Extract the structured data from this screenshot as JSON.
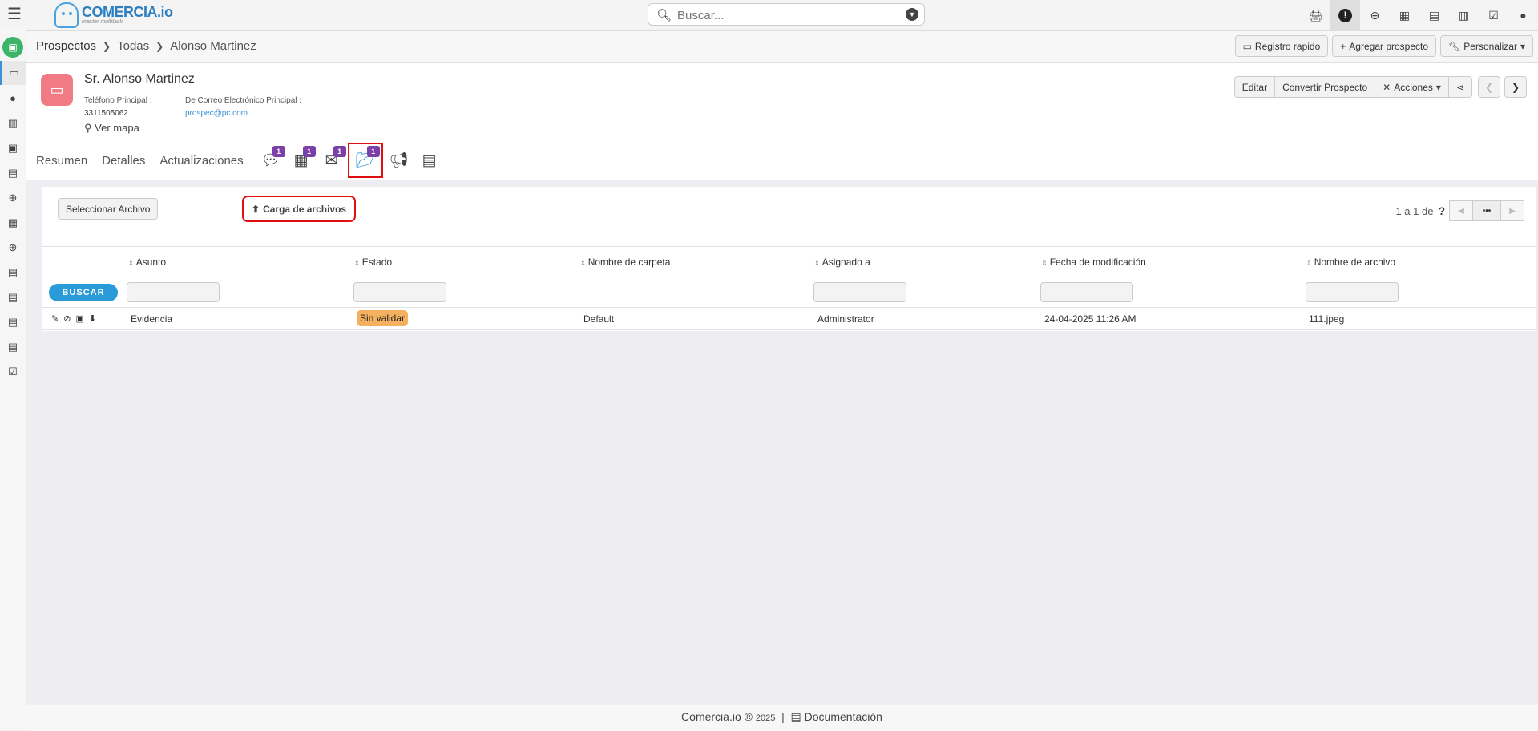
{
  "app": {
    "logo_title": "COMERCIA.io",
    "logo_subtitle": "master multitask",
    "search_placeholder": "Buscar..."
  },
  "breadcrumb": [
    "Prospectos",
    "Todas",
    "Alonso Martinez"
  ],
  "toolbar": {
    "quick_register": "Registro rapido",
    "add_prospect": "Agregar prospecto",
    "customize": "Personalizar"
  },
  "record": {
    "name": "Sr. Alonso Martinez",
    "phone_label": "Teléfono Principal :",
    "phone_value": "3311505062",
    "email_label": "De Correo Electrónico Principal :",
    "email_value": "prospec@pc.com",
    "map_link": "Ver mapa"
  },
  "record_actions": {
    "edit": "Editar",
    "convert": "Convertir Prospecto",
    "actions": "Acciones"
  },
  "tabs": {
    "summary": "Resumen",
    "details": "Detalles",
    "updates": "Actualizaciones",
    "comments_count": "1",
    "events_count": "1",
    "emails_count": "1",
    "documents_count": "1"
  },
  "documents": {
    "select_button": "Seleccionar Archivo",
    "upload_button": "Carga de archivos",
    "pagination_text": "1 a 1  de",
    "search_button": "BUSCAR",
    "columns": [
      "Asunto",
      "Estado",
      "Nombre de carpeta",
      "Asignado a",
      "Fecha de modificación",
      "Nombre de archivo"
    ],
    "rows": [
      {
        "subject": "Evidencia",
        "status": "Sin validar",
        "folder": "Default",
        "assigned_to": "Administrator",
        "modified": "24-04-2025 11:26 AM",
        "filename": "111.jpeg"
      }
    ]
  },
  "footer": {
    "brand": "Comercia.io ®",
    "year": "2025",
    "docs": "Documentación"
  }
}
